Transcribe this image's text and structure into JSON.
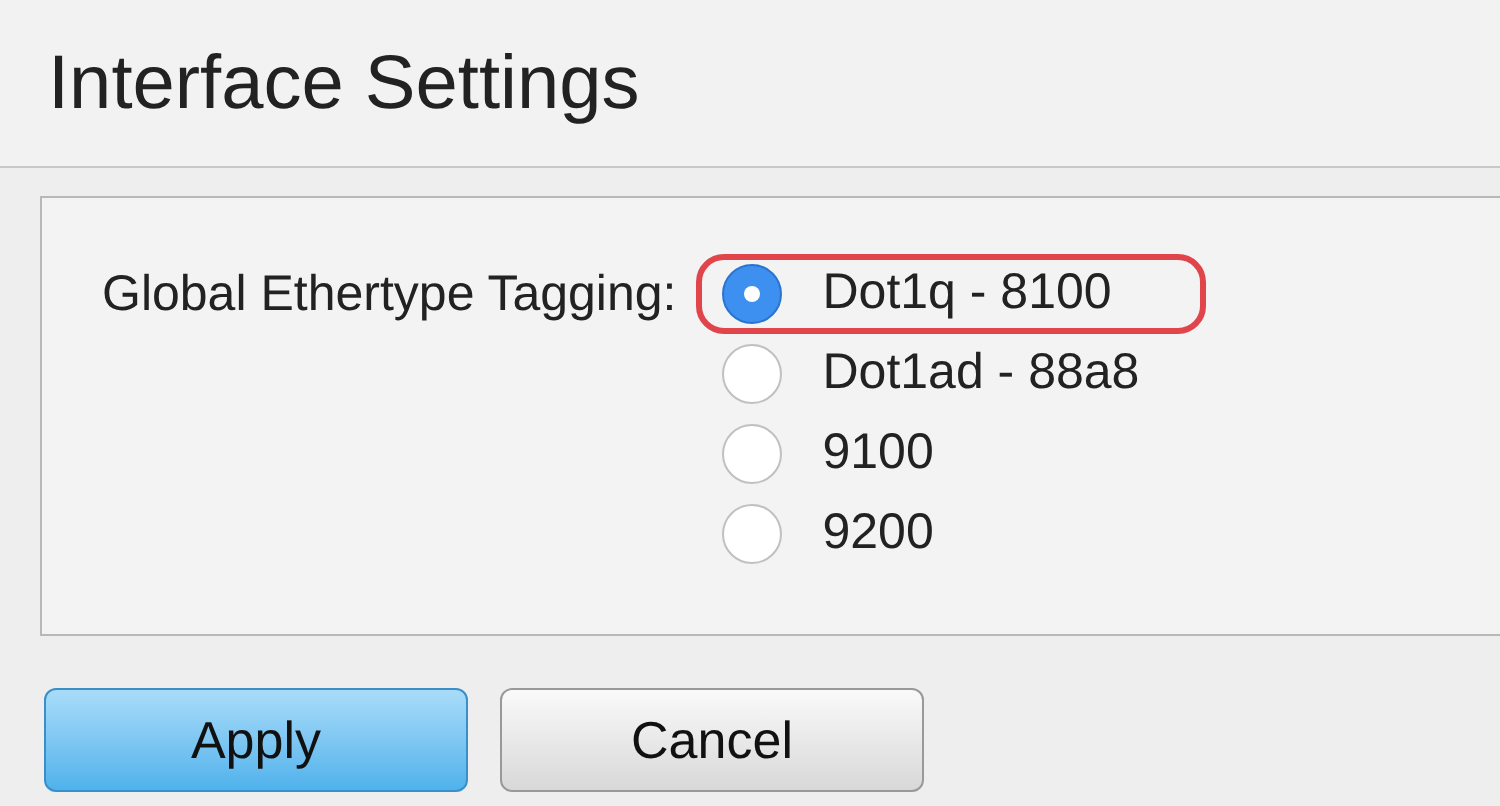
{
  "title": "Interface Settings",
  "field": {
    "label": "Global Ethertype Tagging:",
    "options": [
      {
        "label": "Dot1q - 8100",
        "selected": true,
        "highlighted": true
      },
      {
        "label": "Dot1ad - 88a8",
        "selected": false,
        "highlighted": false
      },
      {
        "label": "9100",
        "selected": false,
        "highlighted": false
      },
      {
        "label": "9200",
        "selected": false,
        "highlighted": false
      }
    ]
  },
  "buttons": [
    {
      "label": "Apply",
      "kind": "primary"
    },
    {
      "label": "Cancel",
      "kind": "secondary"
    }
  ]
}
